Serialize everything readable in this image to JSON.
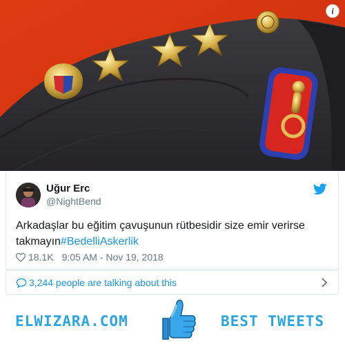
{
  "tweet": {
    "author_name": "Uğur Erc",
    "author_handle": "@NightBend",
    "text": "Arkadaşlar bu eğitim çavuşunun rütbesidir size emir verirse takmayın",
    "hashtag": "#BedelliAskerlik",
    "likes": "18.1K",
    "timestamp": "9:05 AM - Nov 19, 2018",
    "talking": "3,244 people are talking about this"
  },
  "footer": {
    "left_brand": "ELWIZARA.COM",
    "right_brand": "BEST TWEETS"
  },
  "icons": {
    "info": "info-icon",
    "twitter": "twitter-bird-icon",
    "like": "heart-icon",
    "reply": "speech-bubble-icon",
    "chevron": "chevron-right-icon",
    "thumb": "thumbs-up-icon"
  },
  "colors": {
    "accent": "#1b95e0",
    "brand": "#2aa5df",
    "text": "#14171a",
    "muted": "#657786"
  }
}
